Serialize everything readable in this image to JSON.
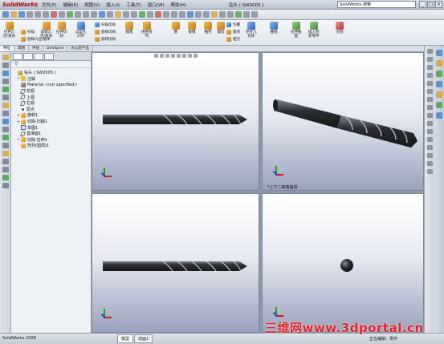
{
  "app": {
    "logo": "SolidWorks",
    "menus": [
      "文件(F)",
      "编辑(E)",
      "视图(V)",
      "插入(I)",
      "工具(T)",
      "窗口(W)",
      "帮助(H)"
    ],
    "doc_title": "钻头 ( SW2005 )",
    "search_placeholder": "SolidWorks 搜索",
    "window_buttons": [
      "_",
      "□",
      "×"
    ]
  },
  "command_manager": {
    "large": [
      {
        "label": "拉伸凸\n台/基体",
        "icon": "extrude-boss-icon",
        "color": "y"
      },
      {
        "label": "旋转凸\n台/基体",
        "icon": "revolve-boss-icon",
        "color": "y"
      },
      {
        "label": "拉伸切\n除",
        "icon": "extrude-cut-icon",
        "color": "y"
      },
      {
        "label": "异型孔\n向导",
        "icon": "hole-wizard-icon",
        "color": "b"
      },
      {
        "label": "圆角",
        "icon": "fillet-icon",
        "color": "y"
      },
      {
        "label": "线性阵\n列",
        "icon": "linear-pattern-icon",
        "color": "y"
      },
      {
        "label": "筋",
        "icon": "rib-icon",
        "color": "y"
      },
      {
        "label": "拔模",
        "icon": "draft-icon",
        "color": "y"
      },
      {
        "label": "抽壳",
        "icon": "shell-icon",
        "color": "y"
      },
      {
        "label": "镜向",
        "icon": "mirror-icon",
        "color": "y"
      },
      {
        "label": "参考几\n何体",
        "icon": "reference-geometry-icon",
        "color": "b"
      },
      {
        "label": "曲线",
        "icon": "curves-icon",
        "color": "b"
      },
      {
        "label": "拉伸曲\n面",
        "icon": "extrude-surface-icon",
        "color": "g"
      },
      {
        "label": "插入到\n新零件",
        "icon": "insert-part-icon",
        "color": "g"
      },
      {
        "label": "分割",
        "icon": "split-icon",
        "color": "r"
      }
    ],
    "small": [
      {
        "label": "扫描",
        "icon": "sweep-icon"
      },
      {
        "label": "放样凸台/基体",
        "icon": "loft-icon"
      },
      {
        "label": "扫描切除",
        "icon": "swept-cut-icon"
      },
      {
        "label": "放样切除",
        "icon": "lofted-cut-icon"
      },
      {
        "label": "旋转切除",
        "icon": "revolve-cut-icon"
      },
      {
        "label": "包覆",
        "icon": "wrap-icon"
      },
      {
        "label": "圆顶",
        "icon": "dome-icon"
      },
      {
        "label": "相交",
        "icon": "intersect-icon"
      }
    ],
    "tabs": [
      "特征",
      "草图",
      "评估",
      "DimXpert",
      "办公室产品"
    ],
    "active_tab": 0
  },
  "feature_tree": {
    "filter": "▽",
    "items": [
      {
        "label": "钻头 ( SW2005 )",
        "icon": "part-icon",
        "type": "part",
        "expand": "",
        "indent": 0
      },
      {
        "label": "注解",
        "icon": "annotations-icon",
        "type": "anno",
        "expand": "+",
        "indent": 1
      },
      {
        "label": "Material <not specified>",
        "icon": "material-icon",
        "type": "mat",
        "expand": "",
        "indent": 1
      },
      {
        "label": "前视",
        "icon": "plane-icon",
        "type": "plane",
        "expand": "",
        "indent": 1
      },
      {
        "label": "上视",
        "icon": "plane-icon",
        "type": "plane",
        "expand": "",
        "indent": 1
      },
      {
        "label": "右视",
        "icon": "plane-icon",
        "type": "plane",
        "expand": "",
        "indent": 1
      },
      {
        "label": "原点",
        "icon": "origin-icon",
        "type": "pt",
        "expand": "",
        "indent": 1
      },
      {
        "label": "旋转1",
        "icon": "revolve-feature-icon",
        "type": "feat",
        "expand": "+",
        "indent": 1
      },
      {
        "label": "切除-扫描1",
        "icon": "cut-sweep-feature-icon",
        "type": "feat",
        "expand": "+",
        "indent": 1
      },
      {
        "label": "草图1",
        "icon": "sketch-icon",
        "type": "sketch",
        "expand": "",
        "indent": 1
      },
      {
        "label": "基准面1",
        "icon": "plane-icon",
        "type": "plane",
        "expand": "",
        "indent": 1
      },
      {
        "label": "切除-拉伸1",
        "icon": "cut-extrude-feature-icon",
        "type": "feat",
        "expand": "+",
        "indent": 1
      },
      {
        "label": "阵列(圆周)1",
        "icon": "circular-pattern-icon",
        "type": "feat",
        "expand": "",
        "indent": 1
      }
    ]
  },
  "viewports": {
    "top_right_label": "*上下二等角轴测"
  },
  "status": {
    "left": "SolidWorks 2008",
    "tabs": [
      "模型",
      "动画1"
    ],
    "right": "正在编辑：零件",
    "watermark": "三维网www.3dportal.cn"
  },
  "colors": {
    "watermark": "#e0242a",
    "viewport_top": "#ffffff",
    "viewport_bottom": "#9aa2bc",
    "drill": "#3a3e44"
  }
}
